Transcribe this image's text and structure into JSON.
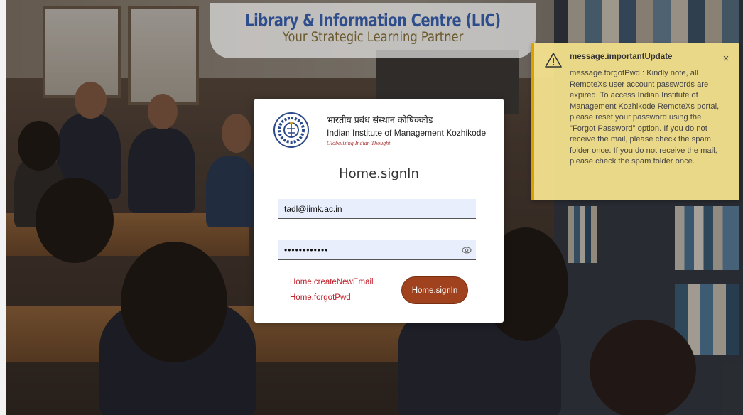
{
  "banner": {
    "title": "Library & Information Centre (LIC)",
    "subtitle": "Your Strategic Learning Partner"
  },
  "institute": {
    "name_hindi": "भारतीय प्रबंध संस्थान कोषिक्कोड",
    "name_english": "Indian Institute of Management Kozhikode",
    "tagline": "Globalizing Indian Thought",
    "logo_icon": "iimk-emblem-icon"
  },
  "login": {
    "title": "Home.signIn",
    "username_value": "tadl@iimk.ac.in",
    "password_value": "••••••••••••",
    "create_email_link": "Home.createNewEmail",
    "forgot_pwd_link": "Home.forgotPwd",
    "signin_button": "Home.signIn"
  },
  "toast": {
    "title": "message.importantUpdate",
    "body": "message.forgotPwd : Kindly note, all RemoteXs user account passwords are expired. To access Indian Institute of Management Kozhikode RemoteXs portal, please reset your password using the \"Forgot Password\" option. If you do not receive the mail, please check the spam folder once. If you do not receive the mail, please check the spam folder once.",
    "close_symbol": "×",
    "icon": "warning-icon"
  },
  "colors": {
    "banner_title": "#2d4d8d",
    "banner_subtitle": "#6b5a2e",
    "link": "#c0202a",
    "button": "#a0421e",
    "toast_bg": "#f4e28e",
    "input_bg": "#e8eefb"
  }
}
